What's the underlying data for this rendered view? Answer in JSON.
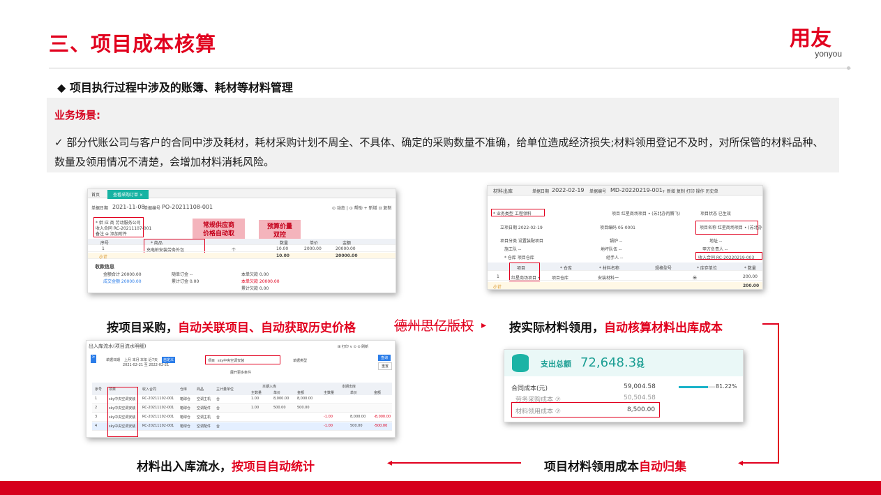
{
  "header": {
    "title": "三、项目成本核算",
    "logo_cn": "用友",
    "logo_en": "yonyou",
    "subhead": "◆  项目执行过程中涉及的账簿、耗材等材料管理"
  },
  "scenario": {
    "label": "业务场景:",
    "text": "✓ 部分代账公司与客户的合同中涉及耗材，耗材采购计划不周全、不具体、确定的采购数量不准确，给单位造成经济损失;材料领用登记不及时，对所保管的材料品种、数量及领用情况不清楚，会增加材料消耗风险。"
  },
  "panel1": {
    "tab_home": "首页",
    "tab_active": "查看采购订单 ×",
    "date_label": "单据日期",
    "date": "2021-11-08",
    "no_label": "单据编号",
    "no": "PO-20211108-001",
    "tools": "⊙ 动态 | ⊙ 帮助  + 新增  ⊡ 复制",
    "supplier": "* 供 应 商  劳动服务公司",
    "contract": "收入合同  RC-20211107-001",
    "remark": "备注  ⊕ 添加附件",
    "tag1": "常规供应商\n价格自动取",
    "tag2": "预算价量\n双控",
    "col_no": "序号",
    "col_item": "* 商品",
    "col_qty": "数量",
    "col_price": "单价",
    "col_amount": "金额",
    "row_no": "1",
    "row_item": "充电桩安装劳务外包",
    "row_unit": "个",
    "row_qty": "10.00",
    "row_price": "2000.00",
    "row_amount": "20000.00",
    "sub_label": "小计",
    "sub_qty": "10.00",
    "sub_amount": "20000.00",
    "info_title": "收款信息",
    "info1": "金额合计  20000.00",
    "info2": "成交金额  20000.00",
    "info3": "随单订金  --",
    "info4": "累计订金  0.00",
    "info5": "本单欠款  0.00",
    "info6": "本单欠款  20000.00",
    "info7": "累计欠款  0.00"
  },
  "panel2": {
    "title": "材料出库",
    "date_label": "单据日期",
    "date": "2022-02-19",
    "no_label": "单据编号",
    "no": "MD-20220219-001",
    "tools": "+ 新增  复制  打印  操作  历史单",
    "biz_type": "* 业务类型  工程领料",
    "project": "项目  红星商场项目 • (苏北办丙腾飞)",
    "status": "项目状态  已生效",
    "start_date": "立项日期  2022-02-19",
    "project_code": "项目编码  05-0001",
    "project_name": "项目名称  红星商场项目 • (苏北办丙腾飞)",
    "category": "项目分类  设置装配项目",
    "manager": "锅炉  --",
    "address": "地址  --",
    "worker": "施工队  --",
    "team": "地坪队伍  --",
    "owner": "甲方负责人  --",
    "warehouse": "* 仓库  项目仓库",
    "handler": "经手人  --",
    "contract": "收入合同  RC-20220219-003",
    "col_project": "项目",
    "col_wh": "* 仓库",
    "col_material": "* 材料名称",
    "col_spec": "规格型号",
    "col_unit": "* 库存单位",
    "col_qty": "* 数量",
    "row_no": "1",
    "row_project": "红星商场项目 •",
    "row_wh": "项目仓库",
    "row_material": "安装材料一",
    "row_unit": "米",
    "row_qty": "200.00",
    "sub_label": "小计",
    "sub_qty": "200.00"
  },
  "panel3": {
    "title": "出入库流水(项目流水明细)",
    "tools": "⊞ 打印 ∨  ⊙  ⊙ 刷新",
    "date_label": "单据日期",
    "date_opts": "上月  本月  本年  近7天",
    "date_sel": "自定义",
    "range": "2021-02-21 至 2022-02-21",
    "project_label": "项目",
    "project_value": "sky中央空调安装",
    "type_label": "单据类型",
    "query": "查询",
    "reset": "重置",
    "expand": "展开更多条件",
    "group_in": "本期入库",
    "group_out": "本期出库",
    "cols": [
      "序号",
      "项目",
      "收入合同",
      "仓库",
      "商品",
      "主计量单位",
      "主数量",
      "单价",
      "金额",
      "主数量",
      "单价",
      "金额"
    ],
    "rows": [
      [
        "1",
        "sky中央空调安装",
        "RC-20211102-001",
        "箱球仓",
        "空调主机",
        "台",
        "1.00",
        "8,000.00",
        "8,000.00",
        "",
        "",
        ""
      ],
      [
        "2",
        "sky中央空调安装",
        "RC-20211102-001",
        "箱球仓",
        "空调配件",
        "台",
        "1.00",
        "500.00",
        "500.00",
        "",
        "",
        ""
      ],
      [
        "3",
        "sky中央空调安装",
        "RC-20211102-001",
        "箱球仓",
        "空调主机",
        "台",
        "",
        "",
        "",
        "-1.00",
        "8,000.00",
        "-8,000.00"
      ],
      [
        "4",
        "sky中央空调安装",
        "RC-20211102-001",
        "箱球仓",
        "空调配件",
        "台",
        "",
        "",
        "",
        "-1.00",
        "500.00",
        "-500.00"
      ]
    ]
  },
  "panel4": {
    "label": "支出总额",
    "total": "72,648.38",
    "unit": "元",
    "r1_label": "合同成本(元)",
    "r1_value": "59,004.58",
    "r1_pct": "81.22%",
    "r1_progress": 0.8122,
    "r2_label": "劳务采购成本 ⑦",
    "r2_value": "50,504.58",
    "r3_label": "材料领用成本 ⑦",
    "r3_value": "8,500.00"
  },
  "captions": {
    "c1_black": "按项目采购，",
    "c1_red": "自动关联项目、自动获取历史价格",
    "c2_black": "按实际材料领用，",
    "c2_red": "自动核算材料出库成本",
    "c3_black": "材料出入库流水，",
    "c3_red": "按项目自动统计",
    "c4_black": "项目材料领用成本",
    "c4_red": "自动归集"
  },
  "watermark": "德州思亿版权",
  "colors": {
    "brand_red": "#e1001e",
    "accent_teal": "#1bb3c9",
    "highlight_blue": "#2b7de9"
  }
}
